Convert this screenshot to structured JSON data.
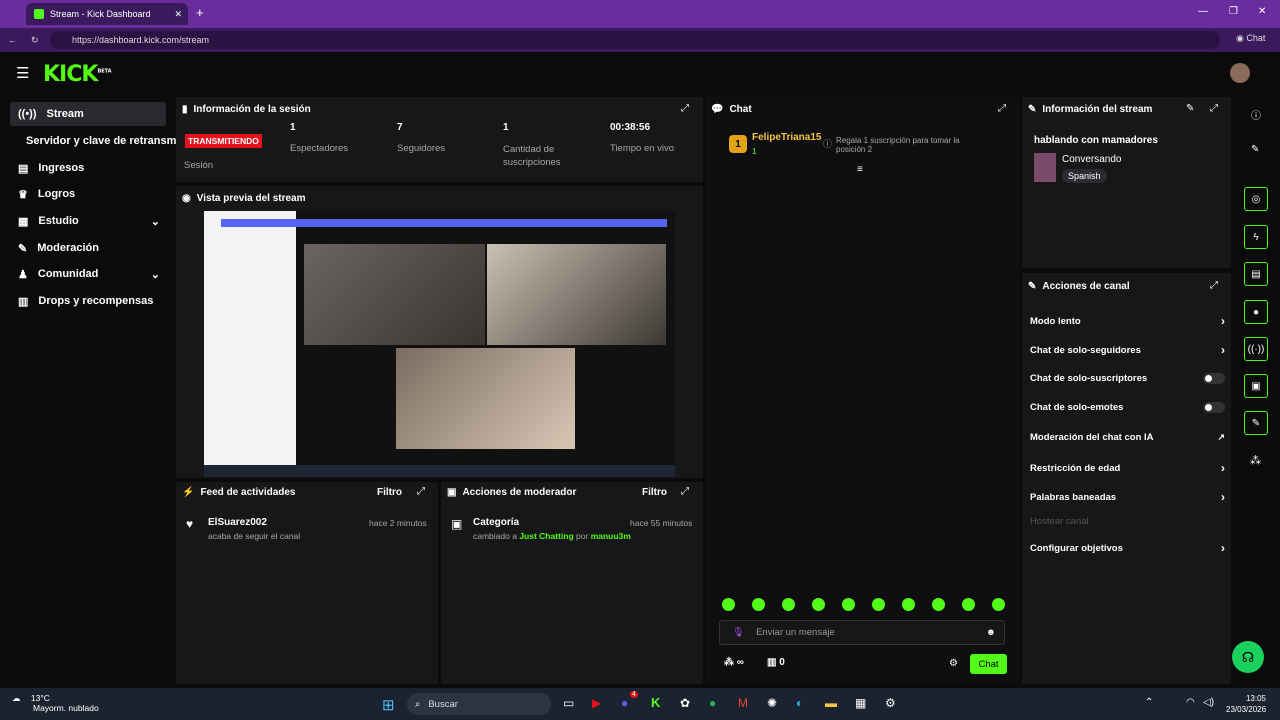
{
  "browser": {
    "tab_title": "Stream - Kick Dashboard",
    "url": "https://dashboard.kick.com/stream",
    "chat_label": "Chat"
  },
  "header": {
    "logo": "KICK",
    "beta": "BETA"
  },
  "sidebar": {
    "items": [
      {
        "label": "Stream",
        "icon": "broadcast-icon"
      },
      {
        "label": "Servidor y clave de retransmisión",
        "icon": ""
      },
      {
        "label": "Ingresos",
        "icon": "revenue-icon"
      },
      {
        "label": "Logros",
        "icon": "trophy-icon"
      },
      {
        "label": "Estudio",
        "icon": "studio-icon"
      },
      {
        "label": "Moderación",
        "icon": "wrench-icon"
      },
      {
        "label": "Comunidad",
        "icon": "community-icon"
      },
      {
        "label": "Drops y recompensas",
        "icon": "gift-icon"
      }
    ]
  },
  "session": {
    "title": "Información de la sesión",
    "status": "TRANSMITIENDO",
    "status_label": "Sesión",
    "stats": [
      {
        "value": "1",
        "label": "Espectadores"
      },
      {
        "value": "7",
        "label": "Seguidores"
      },
      {
        "value": "1",
        "label": "Cantidad de suscripciones"
      },
      {
        "value": "00:38:56",
        "label": "Tiempo en vivo"
      }
    ]
  },
  "preview": {
    "title": "Vista previa del stream"
  },
  "activity": {
    "title": "Feed de actividades",
    "filter": "Filtro",
    "user": "ElSuarez002",
    "text": "acaba de seguir el canal",
    "time": "hace 2 minutos"
  },
  "modactions": {
    "title": "Acciones de moderador",
    "filter": "Filtro",
    "action": "Categoría",
    "time": "hace 55 minutos",
    "text_prefix": "cambiado a",
    "category": "Just Chatting",
    "by": "por",
    "mod": "manuu3m"
  },
  "chat": {
    "title": "Chat",
    "pinned_user": "FelipeTriana15",
    "pinned_count": "1",
    "pinned_note": "Regala 1 suscripción para tomar la posición 2",
    "placeholder": "Enviar un mensaje",
    "send": "Chat",
    "count": "0",
    "infinity": "∞"
  },
  "streaminfo": {
    "title": "Información del stream",
    "stream_title": "hablando con mamadores",
    "category": "Conversando",
    "language": "Spanish"
  },
  "channel_actions": {
    "title": "Acciones de canal",
    "items": [
      {
        "label": "Modo lento",
        "control": "chevron"
      },
      {
        "label": "Chat de solo-seguidores",
        "control": "chevron"
      },
      {
        "label": "Chat de solo-suscriptores",
        "control": "toggle"
      },
      {
        "label": "Chat de solo-emotes",
        "control": "toggle"
      },
      {
        "label": "Moderación del chat con IA",
        "control": "external"
      },
      {
        "label": "Restricción de edad",
        "control": "chevron"
      },
      {
        "label": "Palabras baneadas",
        "control": "chevron"
      },
      {
        "label": "Hostear canal",
        "control": "disabled"
      },
      {
        "label": "Configurar objetivos",
        "control": "chevron"
      }
    ]
  },
  "taskbar": {
    "temp": "13°C",
    "weather": "Mayorm. nublado",
    "search": "Buscar",
    "time": "13:05",
    "date": "23/03/2026",
    "badge": "4"
  },
  "colors": {
    "accent": "#53fc18",
    "live": "#e3121b",
    "panel": "#17171a",
    "bg": "#0b0b0c"
  }
}
